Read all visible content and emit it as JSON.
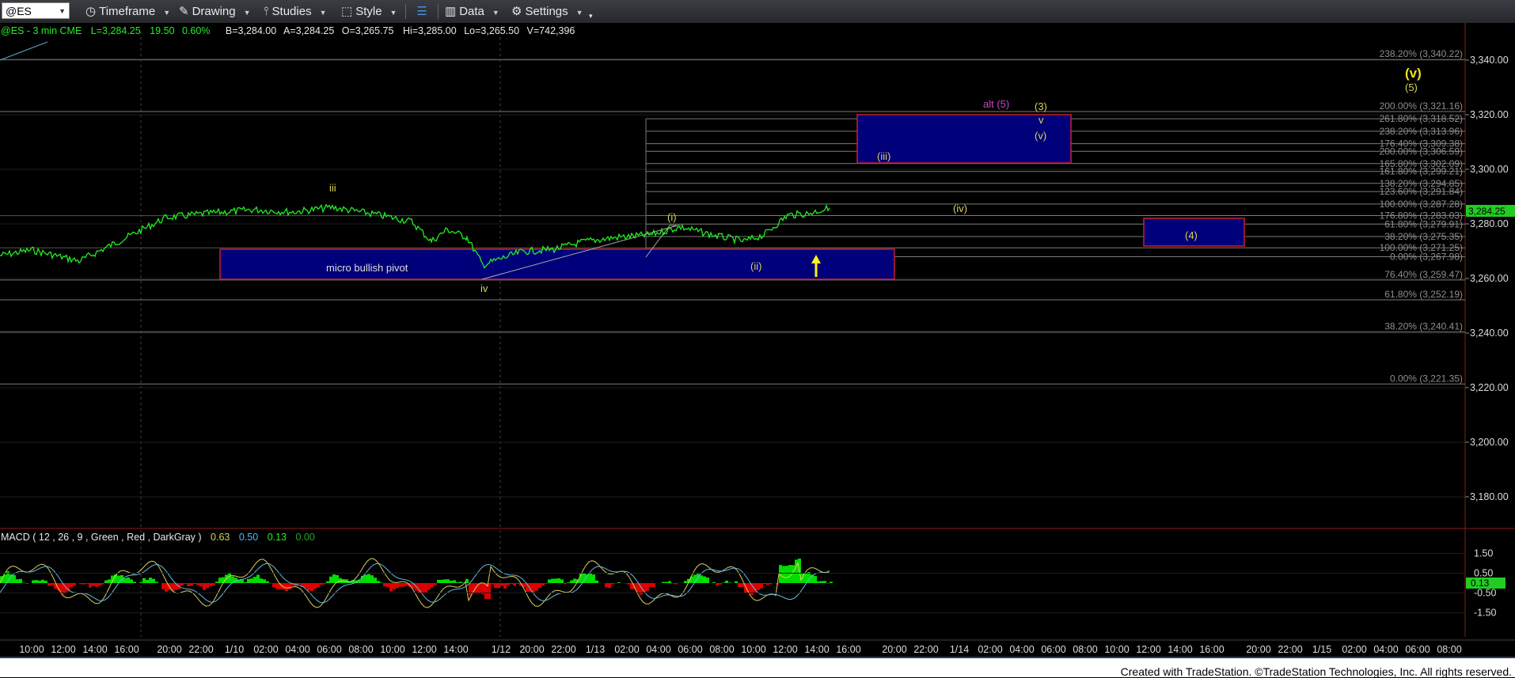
{
  "toolbar": {
    "symbol": "@ES",
    "items": [
      "Timeframe",
      "Drawing",
      "Studies",
      "Style",
      "Data",
      "Settings"
    ]
  },
  "header": {
    "symbol_info": "@ES - 3 min  CME",
    "last": "L=3,284.25",
    "change": "19.50",
    "pct": "0.60%",
    "bid": "B=3,284.00",
    "ask": "A=3,284.25",
    "open": "O=3,265.75",
    "high": "Hi=3,285.00",
    "low": "Lo=3,265.50",
    "volume": "V=742,396"
  },
  "price_axis": {
    "ticks": [
      "3,340.00",
      "3,320.00",
      "3,300.00",
      "3,280.00",
      "3,260.00",
      "3,240.00",
      "3,220.00",
      "3,200.00",
      "3,180.00"
    ],
    "current_price": "3,284.25"
  },
  "fib_left": [
    {
      "label": "76.40% (3,259.47)",
      "price": 3259.47
    },
    {
      "label": "61.80% (3,252.19)",
      "price": 3252.19
    },
    {
      "label": "38.20% (3,240.41)",
      "price": 3240.41
    },
    {
      "label": "0.00% (3,221.35)",
      "price": 3221.35
    },
    {
      "label": "238.20% (3,340.22)",
      "price": 3340.22
    },
    {
      "label": "200.00% (3,321.16)",
      "price": 3321.16
    }
  ],
  "fib_right": [
    {
      "label": "261.80% (3,318.52)",
      "price": 3318.52
    },
    {
      "label": "238.20% (3,313.96)",
      "price": 3313.96
    },
    {
      "label": "176.40% (3,309.38)",
      "price": 3309.38
    },
    {
      "label": "200.00% (3,306.59)",
      "price": 3306.59
    },
    {
      "label": "165.80% (3,302.09)",
      "price": 3302.09
    },
    {
      "label": "161.80% (3,299.21)",
      "price": 3299.21
    },
    {
      "label": "138.20% (3,294.85)",
      "price": 3294.85
    },
    {
      "label": "123.60% (3,291.84)",
      "price": 3291.84
    },
    {
      "label": "100.00% (3,287.28)",
      "price": 3287.28
    },
    {
      "label": "176.80% (3,283.03)",
      "price": 3283.03
    },
    {
      "label": "61.80% (3,279.91)",
      "price": 3279.91
    },
    {
      "label": "38.20% (3,275.35)",
      "price": 3275.35
    },
    {
      "label": "100.00% (3,271.25)",
      "price": 3271.25
    },
    {
      "label": "0.00% (3,267.98)",
      "price": 3267.98
    }
  ],
  "annotations": {
    "iii_small": "iii",
    "iv_small": "iv",
    "wave_i": "(i)",
    "wave_ii": "(ii)",
    "wave_iii": "(iii)",
    "wave_iv": "(iv)",
    "wave_v": "(v)",
    "wave_v_small": "v",
    "wave_3": "(3)",
    "wave_4": "(4)",
    "wave_5": "(5)",
    "alt_5": "alt (5)",
    "big_v": "(v)",
    "pivot": "micro bullish pivot"
  },
  "macd": {
    "label": "MACD ( 12 , 26 , 9 , Green , Red , DarkGray )",
    "v1": "0.63",
    "v2": "0.50",
    "v3": "0.13",
    "v4": "0.00",
    "ticks": [
      "1.50",
      "0.50",
      "-0.50",
      "-1.50"
    ],
    "current": "0.13"
  },
  "time_axis": [
    "10:00",
    "12:00",
    "14:00",
    "16:00",
    "20:00",
    "22:00",
    "1/10",
    "02:00",
    "04:00",
    "06:00",
    "08:00",
    "10:00",
    "12:00",
    "14:00",
    "1/12",
    "20:00",
    "22:00",
    "1/13",
    "02:00",
    "04:00",
    "06:00",
    "08:00",
    "10:00",
    "12:00",
    "14:00",
    "16:00",
    "20:00",
    "22:00",
    "1/14",
    "02:00",
    "04:00",
    "06:00",
    "08:00",
    "10:00",
    "12:00",
    "14:00",
    "16:00",
    "20:00",
    "22:00",
    "1/15",
    "02:00",
    "04:00",
    "06:00",
    "08:00"
  ],
  "footer": {
    "credit": "Created with TradeStation. ©TradeStation Technologies, Inc. All rights reserved."
  },
  "colors": {
    "price_line": "#22ee22",
    "box_fill": "#00007a",
    "box_border": "#c8202a",
    "wave_label": "#d8d060",
    "alt_label": "#cc44cc",
    "fib_line": "#8a8a8a",
    "macd_pos": "#00dd00",
    "macd_neg": "#dd0000"
  }
}
